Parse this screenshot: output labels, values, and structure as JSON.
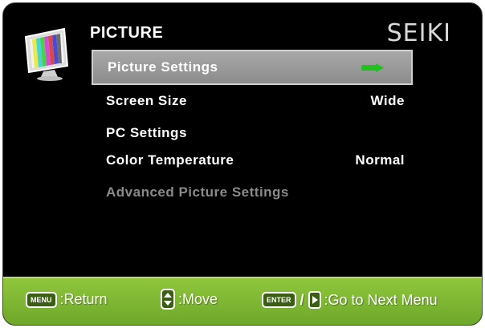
{
  "header": {
    "title": "PICTURE",
    "brand": "SEIKI"
  },
  "icons": {
    "monitor": "color-bars-monitor-icon",
    "arrow": "green-right-arrow-icon",
    "updown": "up-down-key-icon",
    "right": "right-key-icon"
  },
  "colors": {
    "osd_background": "#000000",
    "selected_bar": "#9a9a9a",
    "footer_green": "#7db733",
    "arrow_green": "#22c01e",
    "disabled_text": "#8a8a8a"
  },
  "menu": {
    "items": [
      {
        "label": "Picture Settings",
        "value": ""
      },
      {
        "label": "Screen Size",
        "value": "Wide"
      },
      {
        "label": "PC Settings",
        "value": ""
      },
      {
        "label": "Color Temperature",
        "value": "Normal"
      },
      {
        "label": "Advanced Picture Settings",
        "value": ""
      }
    ],
    "selected_index": 0
  },
  "footer": {
    "menu_key": "MENU",
    "return_label": ":Return",
    "move_label": ":Move",
    "enter_key": "ENTER",
    "slash": "/",
    "next_label": ":Go to Next Menu"
  }
}
